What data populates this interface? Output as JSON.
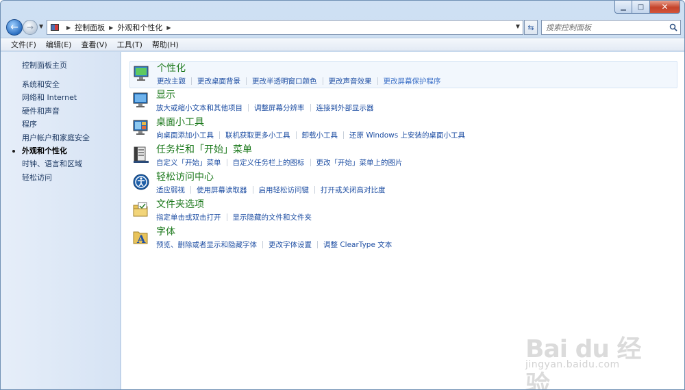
{
  "window": {
    "minimize": "▁",
    "maximize": "□",
    "close": "✕"
  },
  "navigation": {
    "back_icon": "←",
    "forward_icon": "→",
    "breadcrumb": [
      "控制面板",
      "外观和个性化"
    ],
    "search_placeholder": "搜索控制面板"
  },
  "menu": [
    "文件(F)",
    "编辑(E)",
    "查看(V)",
    "工具(T)",
    "帮助(H)"
  ],
  "sidebar": {
    "home": "控制面板主页",
    "items": [
      {
        "label": "系统和安全",
        "active": false
      },
      {
        "label": "网络和 Internet",
        "active": false
      },
      {
        "label": "硬件和声音",
        "active": false
      },
      {
        "label": "程序",
        "active": false
      },
      {
        "label": "用户帐户和家庭安全",
        "active": false
      },
      {
        "label": "外观和个性化",
        "active": true
      },
      {
        "label": "时钟、语言和区域",
        "active": false
      },
      {
        "label": "轻松访问",
        "active": false
      }
    ]
  },
  "categories": [
    {
      "title": "个性化",
      "icon": "personalization-icon",
      "links": [
        "更改主题",
        "更改桌面背景",
        "更改半透明窗口颜色",
        "更改声音效果",
        "更改屏幕保护程序"
      ]
    },
    {
      "title": "显示",
      "icon": "display-icon",
      "links": [
        "放大或缩小文本和其他项目",
        "调整屏幕分辨率",
        "连接到外部显示器"
      ]
    },
    {
      "title": "桌面小工具",
      "icon": "gadgets-icon",
      "links": [
        "向桌面添加小工具",
        "联机获取更多小工具",
        "卸载小工具",
        "还原 Windows 上安装的桌面小工具"
      ]
    },
    {
      "title": "任务栏和「开始」菜单",
      "icon": "taskbar-icon",
      "links": [
        "自定义「开始」菜单",
        "自定义任务栏上的图标",
        "更改「开始」菜单上的图片"
      ]
    },
    {
      "title": "轻松访问中心",
      "icon": "ease-of-access-icon",
      "links": [
        "适应弱视",
        "使用屏幕读取器",
        "启用轻松访问键",
        "打开或关闭高对比度"
      ]
    },
    {
      "title": "文件夹选项",
      "icon": "folder-options-icon",
      "links": [
        "指定单击或双击打开",
        "显示隐藏的文件和文件夹"
      ]
    },
    {
      "title": "字体",
      "icon": "fonts-icon",
      "links": [
        "预览、删除或者显示和隐藏字体",
        "更改字体设置",
        "调整 ClearType 文本"
      ]
    }
  ],
  "watermark": {
    "brand": "Bai du 经验",
    "url": "jingyan.baidu.com"
  },
  "colors": {
    "category_title": "#1e7a1e",
    "link": "#1f4fa3",
    "sidebar_bg": "#dce7f6"
  }
}
